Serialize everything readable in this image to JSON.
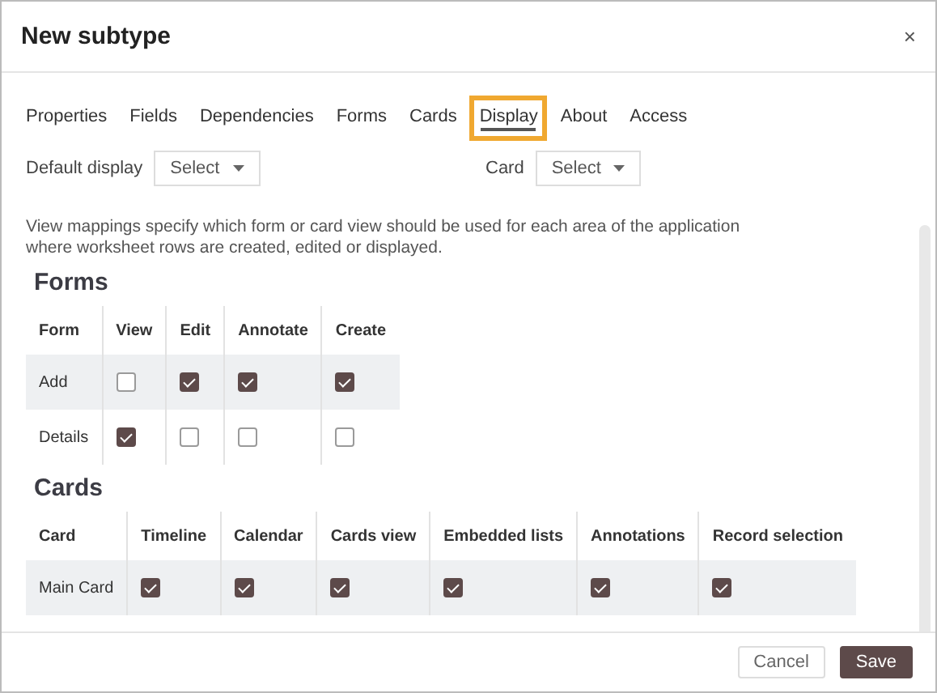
{
  "window": {
    "title": "New subtype",
    "close": "×"
  },
  "tabs": [
    {
      "label": "Properties",
      "selected": false,
      "highlighted": false
    },
    {
      "label": "Fields",
      "selected": false,
      "highlighted": false
    },
    {
      "label": "Dependencies",
      "selected": false,
      "highlighted": false
    },
    {
      "label": "Forms",
      "selected": false,
      "highlighted": false
    },
    {
      "label": "Cards",
      "selected": false,
      "highlighted": false
    },
    {
      "label": "Display",
      "selected": true,
      "highlighted": true
    },
    {
      "label": "About",
      "selected": false,
      "highlighted": false
    },
    {
      "label": "Access",
      "selected": false,
      "highlighted": false
    }
  ],
  "selects": [
    {
      "label": "Default display",
      "value": "Select"
    },
    {
      "label": "Card",
      "value": "Select"
    }
  ],
  "description": "View mappings specify which form or card view should be used for each area of the application where worksheet rows are created, edited or displayed.",
  "sections": [
    {
      "title": "Forms",
      "columns": [
        "Form",
        "View",
        "Edit",
        "Annotate",
        "Create"
      ],
      "rows": [
        {
          "name": "Add",
          "shaded": true,
          "checks": [
            false,
            true,
            true,
            true
          ]
        },
        {
          "name": "Details",
          "shaded": false,
          "checks": [
            true,
            false,
            false,
            false
          ]
        }
      ]
    },
    {
      "title": "Cards",
      "columns": [
        "Card",
        "Timeline",
        "Calendar",
        "Cards view",
        "Embedded lists",
        "Annotations",
        "Record selection"
      ],
      "rows": [
        {
          "name": "Main Card",
          "shaded": true,
          "checks": [
            true,
            true,
            true,
            true,
            true,
            true
          ]
        }
      ]
    }
  ],
  "buttons": [
    {
      "label": "Cancel",
      "kind": "secondary"
    },
    {
      "label": "Save",
      "kind": "primary"
    }
  ]
}
